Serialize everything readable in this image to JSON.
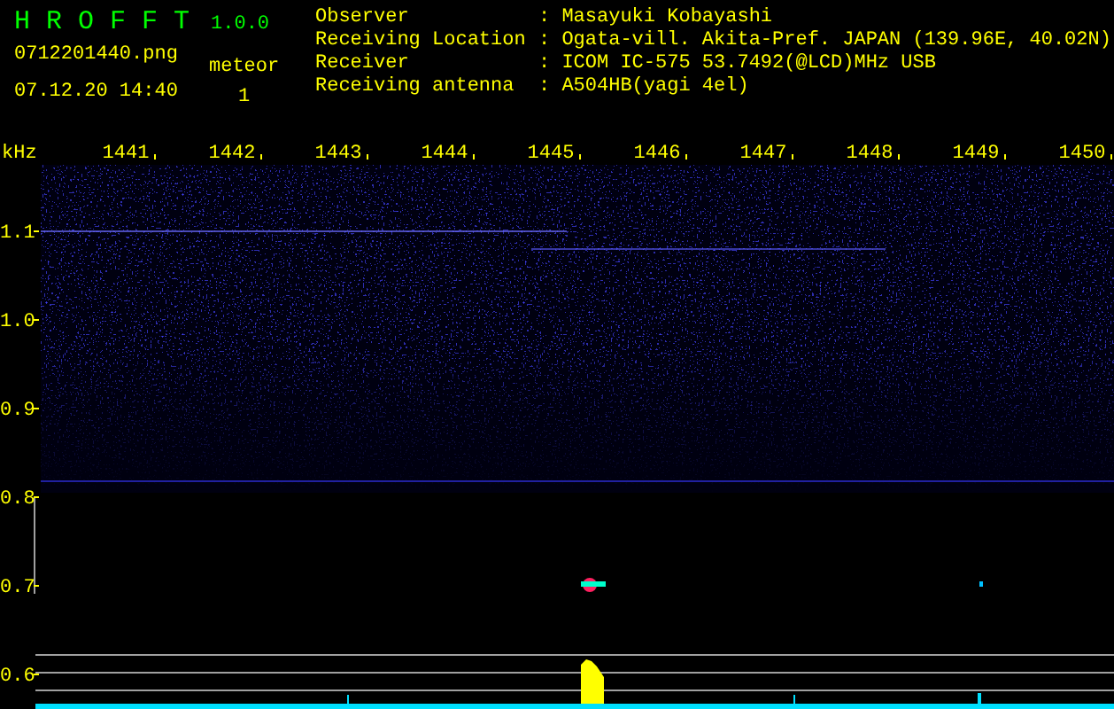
{
  "app": {
    "title": "H R O F F T",
    "version": "1.0.0"
  },
  "file": {
    "name": "0712201440.png",
    "datetime": "07.12.20 14:40"
  },
  "detection": {
    "label": "meteor",
    "count": "1"
  },
  "station": [
    {
      "label": "Observer",
      "value": ": Masayuki Kobayashi"
    },
    {
      "label": "Receiving Location",
      "value": ": Ogata-vill. Akita-Pref. JAPAN (139.96E, 40.02N)"
    },
    {
      "label": "Receiver",
      "value": ": ICOM IC-575 53.7492(@LCD)MHz USB"
    },
    {
      "label": "Receiving antenna",
      "value": ": A504HB(yagi 4el)"
    }
  ],
  "plot": {
    "y_unit": "kHz",
    "x_labels": [
      "1441",
      "1442",
      "1443",
      "1444",
      "1445",
      "1446",
      "1447",
      "1448",
      "1449",
      "1450"
    ],
    "y_labels": [
      "1.1",
      "1.0",
      "0.9",
      "0.8",
      "0.7",
      "0.6"
    ]
  }
}
